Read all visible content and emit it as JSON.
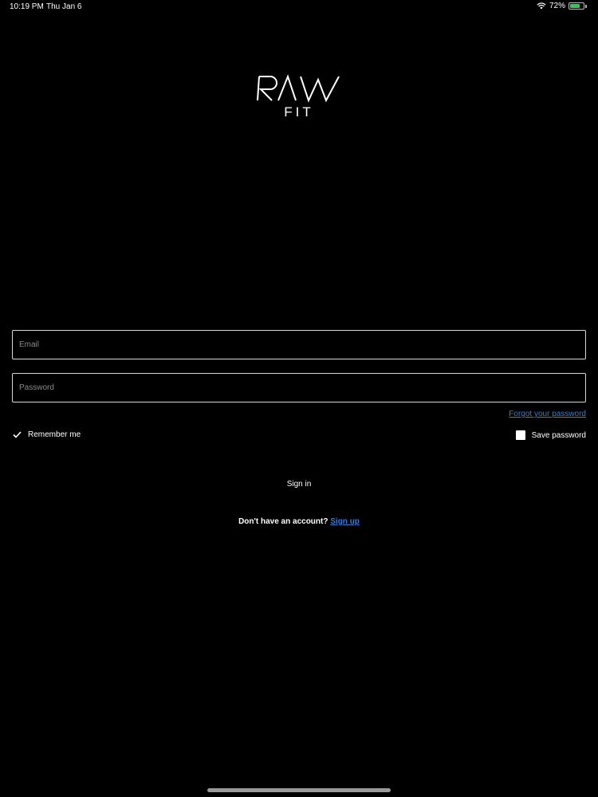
{
  "status_bar": {
    "time": "10:19 PM",
    "date": "Thu Jan 6",
    "wifi_icon": "wifi-icon",
    "battery_percent": "72%",
    "battery_level": 0.72,
    "battery_icon": "battery-charging-icon"
  },
  "logo": {
    "brand": "RAW",
    "sub": "FIT"
  },
  "form": {
    "email": {
      "value": "",
      "placeholder": "Email"
    },
    "password": {
      "value": "",
      "placeholder": "Password"
    },
    "forgot_label": "Forgot your password",
    "remember_label": "Remember me",
    "remember_checked": true,
    "save_label": "Save password",
    "save_checked": false,
    "signin_label": "Sign in",
    "signup_prompt": "Don't have an account?",
    "signup_label": "Sign up"
  },
  "colors": {
    "background": "#000000",
    "link": "#2f7fd9",
    "field_border": "#d8d8d8"
  }
}
